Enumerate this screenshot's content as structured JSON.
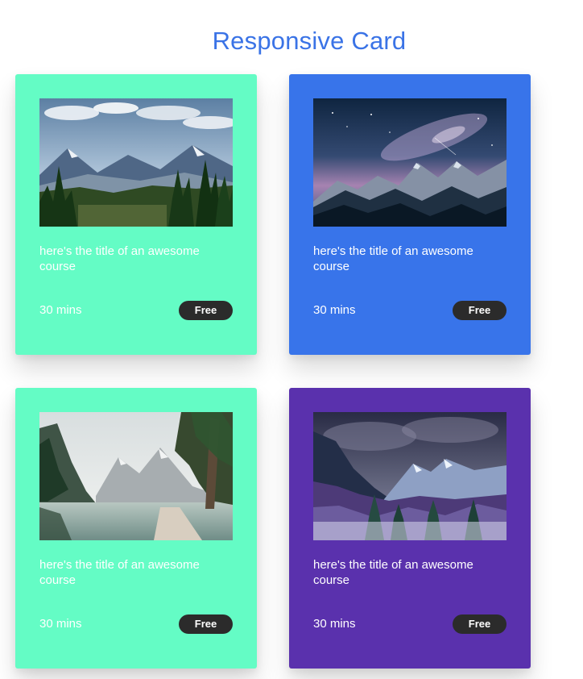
{
  "page": {
    "title": "Responsive Card"
  },
  "cards": [
    {
      "background": "#64fcc5",
      "image": "mountain-valley-forest-image",
      "title": "here's the title of an awesome course",
      "duration": "30 mins",
      "badge": "Free"
    },
    {
      "background": "#3874ea",
      "image": "milky-way-mountain-image",
      "title": "here's the title of an awesome course",
      "duration": "30 mins",
      "badge": "Free"
    },
    {
      "background": "#64fcc5",
      "image": "mountain-lake-image",
      "title": "here's the title of an awesome course",
      "duration": "30 mins",
      "badge": "Free"
    },
    {
      "background": "#5a31ad",
      "image": "snowy-valley-image",
      "title": "here's the title of an awesome course",
      "duration": "30 mins",
      "badge": "Free"
    }
  ],
  "colors": {
    "heading": "#3a73e6",
    "badge_background": "#2b2b2b",
    "text": "#ffffff"
  }
}
